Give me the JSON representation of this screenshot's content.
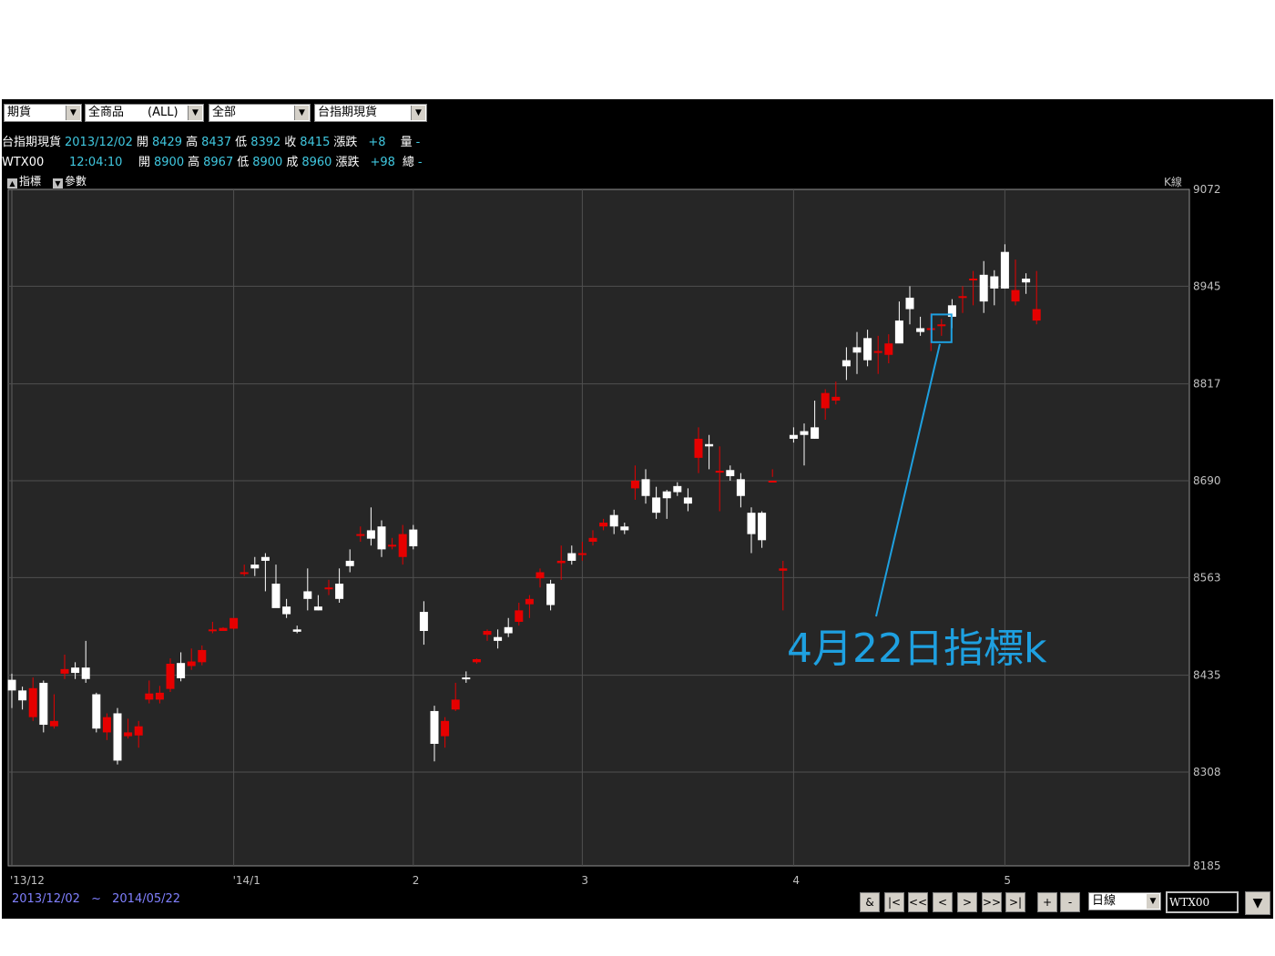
{
  "toolbar": {
    "select1": "期貨",
    "select2": "全商品　　(ALL)",
    "select3": "全部",
    "select4": "台指期現貨"
  },
  "quote1": {
    "name": "台指期現貨",
    "date": "2013/12/02",
    "open_label": "開",
    "open": "8429",
    "high_label": "高",
    "high": "8437",
    "low_label": "低",
    "low": "8392",
    "close_label": "收",
    "close": "8415",
    "chg_label": "漲跌",
    "chg": "+8",
    "vol_label": "量",
    "vol": "-"
  },
  "quote2": {
    "name": "WTX00",
    "time": "12:04:10",
    "open_label": "開",
    "open": "8900",
    "high_label": "高",
    "high": "8967",
    "low_label": "低",
    "low": "8900",
    "close_label": "成",
    "close": "8960",
    "chg_label": "漲跌",
    "chg": "+98",
    "vol_label": "總",
    "vol": "-"
  },
  "panel": {
    "indicator_label": "指標",
    "param_label": "參數",
    "kline_label": "K線"
  },
  "range": {
    "start": "2013/12/02",
    "sep": "~",
    "end": "2014/05/22"
  },
  "bottom_toolbar": {
    "buttons": [
      "&",
      "|<",
      "<<",
      "<",
      ">",
      ">>",
      ">|",
      "+",
      "-"
    ],
    "period": "日線",
    "symbol": "WTX00"
  },
  "annotation": {
    "text": "4月22日指標k",
    "color": "#1ea0e0"
  },
  "colors": {
    "up": "#e60000",
    "down": "#ffffff",
    "grid": "#505050",
    "bg": "#262626",
    "label": "#40c8e0"
  },
  "chart_data": {
    "type": "candlestick",
    "y_ticks": [
      9072,
      8945,
      8817,
      8690,
      8563,
      8435,
      8308,
      8185
    ],
    "ylim": [
      8185,
      9072
    ],
    "x_labels": [
      {
        "index": 0,
        "label": "'13/12"
      },
      {
        "index": 21,
        "label": "'14/1"
      },
      {
        "index": 38,
        "label": "2"
      },
      {
        "index": 54,
        "label": "3"
      },
      {
        "index": 74,
        "label": "4"
      },
      {
        "index": 94,
        "label": "5"
      }
    ],
    "candles": [
      [
        8429,
        8437,
        8392,
        8415
      ],
      [
        8415,
        8420,
        8390,
        8402
      ],
      [
        8380,
        8432,
        8375,
        8418
      ],
      [
        8425,
        8428,
        8360,
        8370
      ],
      [
        8368,
        8410,
        8365,
        8375
      ],
      [
        8437,
        8462,
        8430,
        8443
      ],
      [
        8445,
        8452,
        8430,
        8438
      ],
      [
        8445,
        8480,
        8425,
        8430
      ],
      [
        8410,
        8412,
        8360,
        8365
      ],
      [
        8360,
        8385,
        8350,
        8380
      ],
      [
        8385,
        8392,
        8318,
        8323
      ],
      [
        8355,
        8378,
        8352,
        8360
      ],
      [
        8356,
        8375,
        8340,
        8368
      ],
      [
        8403,
        8428,
        8398,
        8411
      ],
      [
        8403,
        8421,
        8398,
        8412
      ],
      [
        8417,
        8457,
        8413,
        8450
      ],
      [
        8451,
        8465,
        8427,
        8431
      ],
      [
        8447,
        8470,
        8442,
        8453
      ],
      [
        8452,
        8474,
        8448,
        8468
      ],
      [
        8493,
        8505,
        8490,
        8495
      ],
      [
        8493,
        8498,
        8493,
        8497
      ],
      [
        8496,
        8508,
        8495,
        8510
      ],
      [
        8568,
        8580,
        8565,
        8570
      ],
      [
        8580,
        8590,
        8565,
        8575
      ],
      [
        8590,
        8595,
        8545,
        8585
      ],
      [
        8555,
        8580,
        8530,
        8523
      ],
      [
        8525,
        8535,
        8510,
        8515
      ],
      [
        8495,
        8500,
        8490,
        8492
      ],
      [
        8545,
        8575,
        8520,
        8535
      ],
      [
        8525,
        8540,
        8520,
        8520
      ],
      [
        8550,
        8560,
        8540,
        8550
      ],
      [
        8555,
        8575,
        8530,
        8535
      ],
      [
        8585,
        8600,
        8570,
        8578
      ],
      [
        8620,
        8630,
        8610,
        8620
      ],
      [
        8625,
        8655,
        8605,
        8614
      ],
      [
        8630,
        8638,
        8590,
        8600
      ],
      [
        8604,
        8615,
        8600,
        8606
      ],
      [
        8590,
        8632,
        8580,
        8620
      ],
      [
        8626,
        8632,
        8600,
        8604
      ],
      [
        8518,
        8532,
        8475,
        8493
      ],
      [
        8388,
        8395,
        8322,
        8345
      ],
      [
        8355,
        8380,
        8340,
        8375
      ],
      [
        8390,
        8425,
        8388,
        8403
      ],
      [
        8432,
        8440,
        8425,
        8430
      ],
      [
        8452,
        8457,
        8450,
        8456
      ],
      [
        8488,
        8495,
        8480,
        8493
      ],
      [
        8485,
        8495,
        8470,
        8480
      ],
      [
        8498,
        8510,
        8485,
        8490
      ],
      [
        8505,
        8530,
        8500,
        8520
      ],
      [
        8528,
        8540,
        8510,
        8535
      ],
      [
        8562,
        8575,
        8550,
        8570
      ],
      [
        8555,
        8560,
        8520,
        8527
      ],
      [
        8582,
        8605,
        8560,
        8585
      ],
      [
        8595,
        8605,
        8580,
        8585
      ],
      [
        8595,
        8610,
        8585,
        8595
      ],
      [
        8610,
        8625,
        8605,
        8615
      ],
      [
        8630,
        8640,
        8625,
        8635
      ],
      [
        8645,
        8652,
        8620,
        8630
      ],
      [
        8630,
        8635,
        8620,
        8625
      ],
      [
        8680,
        8710,
        8665,
        8690
      ],
      [
        8692,
        8705,
        8660,
        8670
      ],
      [
        8668,
        8682,
        8640,
        8648
      ],
      [
        8676,
        8678,
        8640,
        8667
      ],
      [
        8683,
        8688,
        8670,
        8675
      ],
      [
        8668,
        8680,
        8650,
        8660
      ],
      [
        8720,
        8760,
        8700,
        8745
      ],
      [
        8738,
        8750,
        8705,
        8735
      ],
      [
        8703,
        8735,
        8650,
        8703
      ],
      [
        8704,
        8710,
        8690,
        8696
      ],
      [
        8692,
        8700,
        8655,
        8670
      ],
      [
        8648,
        8655,
        8595,
        8620
      ],
      [
        8648,
        8650,
        8602,
        8612
      ],
      [
        8690,
        8705,
        8695,
        8690
      ],
      [
        8572,
        8585,
        8520,
        8575
      ],
      [
        8750,
        8760,
        8740,
        8745
      ],
      [
        8755,
        8765,
        8710,
        8750
      ],
      [
        8760,
        8795,
        8745,
        8745
      ],
      [
        8785,
        8810,
        8770,
        8805
      ],
      [
        8795,
        8820,
        8790,
        8800
      ],
      [
        8848,
        8865,
        8822,
        8840
      ],
      [
        8865,
        8885,
        8830,
        8858
      ],
      [
        8877,
        8888,
        8840,
        8848
      ],
      [
        8860,
        8880,
        8830,
        8860
      ],
      [
        8855,
        8882,
        8844,
        8870
      ],
      [
        8900,
        8925,
        8875,
        8870
      ],
      [
        8930,
        8945,
        8895,
        8915
      ],
      [
        8890,
        8905,
        8880,
        8885
      ],
      [
        8890,
        8910,
        8860,
        8890
      ],
      [
        8895,
        8902,
        8880,
        8895
      ],
      [
        8920,
        8928,
        8890,
        8905
      ],
      [
        8930,
        8945,
        8910,
        8932
      ],
      [
        8955,
        8965,
        8920,
        8955
      ],
      [
        8960,
        8978,
        8910,
        8925
      ],
      [
        8958,
        8966,
        8920,
        8942
      ],
      [
        8990,
        9000,
        8942,
        8942
      ],
      [
        8925,
        8980,
        8920,
        8940
      ],
      [
        8955,
        8962,
        8935,
        8950
      ],
      [
        8900,
        8965,
        8895,
        8915
      ]
    ]
  }
}
